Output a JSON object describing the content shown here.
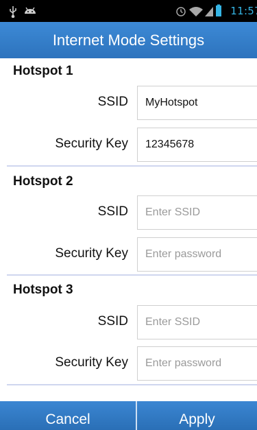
{
  "status_bar": {
    "time": "11:57",
    "icons": [
      "usb-icon",
      "android-debug-icon",
      "alarm-icon",
      "wifi-icon",
      "signal-icon",
      "battery-icon"
    ]
  },
  "title": "Internet Mode Settings",
  "hotspots": [
    {
      "header": "Hotspot 1",
      "ssid_label": "SSID",
      "ssid_value": "MyHotspot",
      "ssid_placeholder": "",
      "key_label": "Security Key",
      "key_value": "12345678",
      "key_placeholder": ""
    },
    {
      "header": "Hotspot 2",
      "ssid_label": "SSID",
      "ssid_value": "",
      "ssid_placeholder": "Enter SSID",
      "key_label": "Security Key",
      "key_value": "",
      "key_placeholder": "Enter password"
    },
    {
      "header": "Hotspot 3",
      "ssid_label": "SSID",
      "ssid_value": "",
      "ssid_placeholder": "Enter SSID",
      "key_label": "Security Key",
      "key_value": "",
      "key_placeholder": "Enter password"
    }
  ],
  "buttons": {
    "cancel": "Cancel",
    "apply": "Apply"
  },
  "colors": {
    "accent": "#2d73bd",
    "status_time": "#35b5e5",
    "divider": "#cfd6ef"
  }
}
